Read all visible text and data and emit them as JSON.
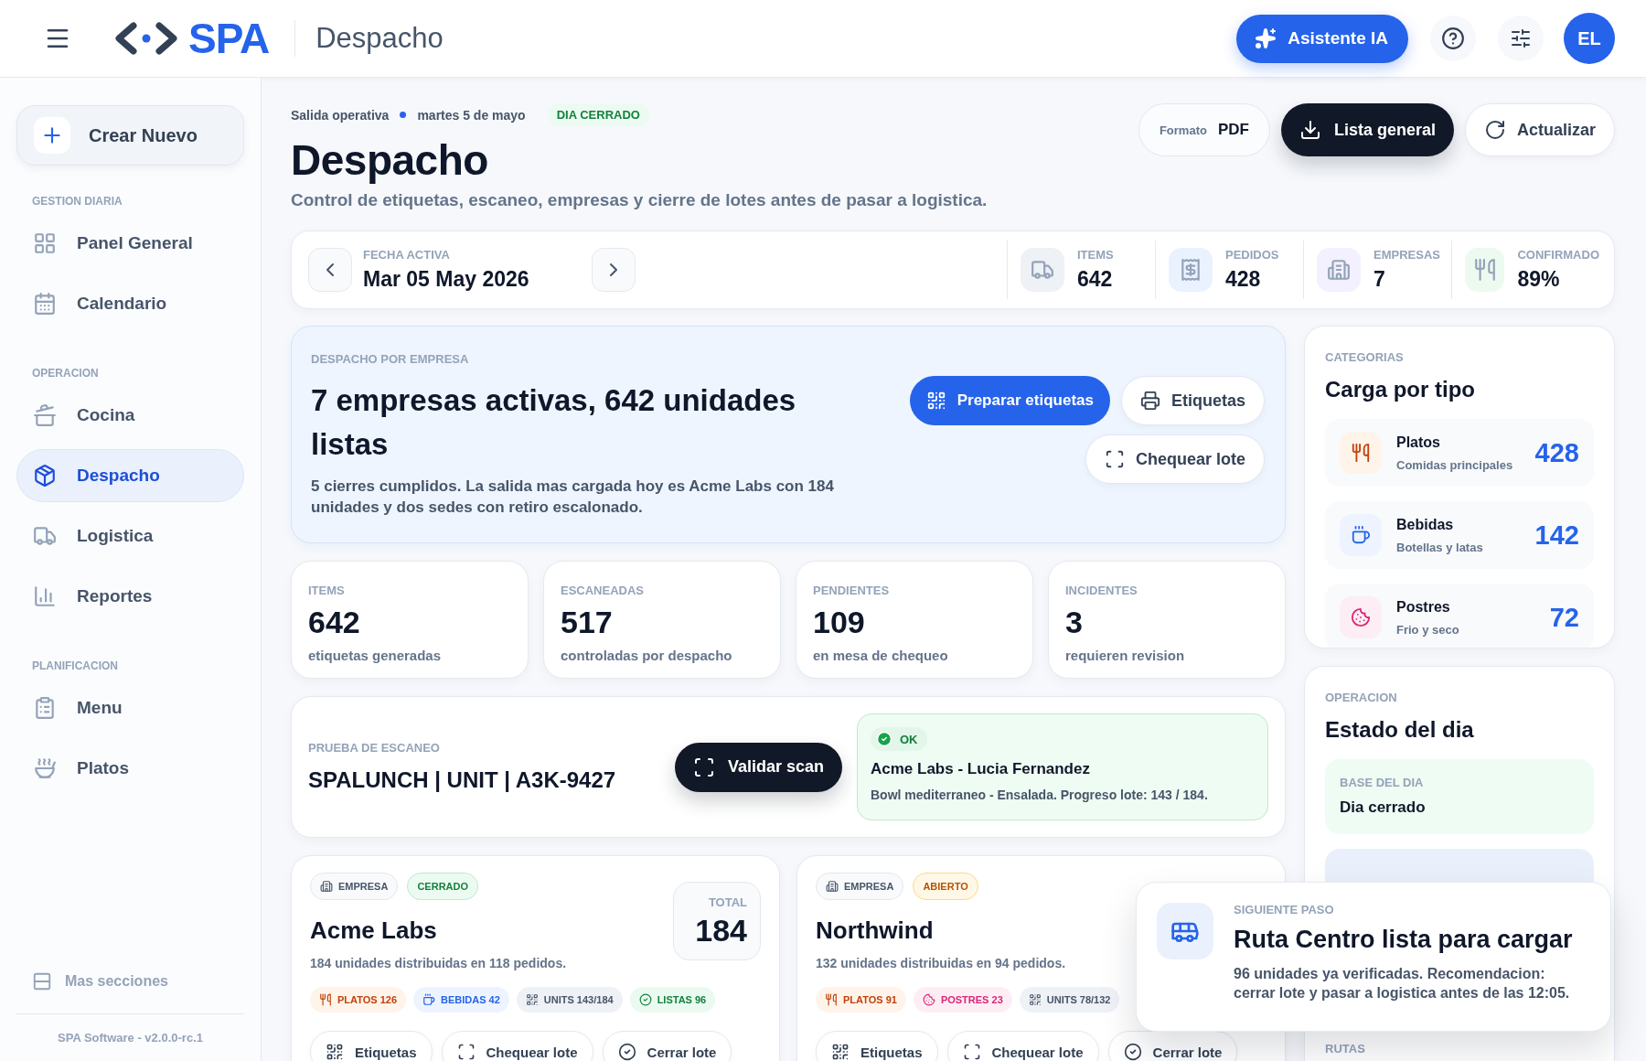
{
  "header": {
    "logo_text": "SPA",
    "page_title": "Despacho",
    "assistant_button": "Asistente IA",
    "avatar": "EL"
  },
  "sidebar": {
    "create_button": "Crear Nuevo",
    "sections": [
      {
        "title": "GESTION DIARIA",
        "items": [
          {
            "label": "Panel General",
            "selected": false
          },
          {
            "label": "Calendario",
            "selected": false
          }
        ]
      },
      {
        "title": "OPERACION",
        "items": [
          {
            "label": "Cocina",
            "selected": false
          },
          {
            "label": "Despacho",
            "selected": true
          },
          {
            "label": "Logistica",
            "selected": false
          },
          {
            "label": "Reportes",
            "selected": false
          }
        ]
      },
      {
        "title": "PLANIFICACION",
        "items": [
          {
            "label": "Menu",
            "selected": false
          },
          {
            "label": "Platos",
            "selected": false
          }
        ]
      }
    ],
    "more_link": "Mas secciones",
    "footer": "SPA Software - v2.0.0-rc.1"
  },
  "page": {
    "breadcrumb": [
      "Salida operativa",
      "martes 5 de mayo"
    ],
    "status_badge": "DIA CERRADO",
    "title": "Despacho",
    "subtitle": "Control de etiquetas, escaneo, empresas y cierre de lotes antes de pasar a logistica.",
    "format": {
      "label": "Formato",
      "value": "PDF"
    },
    "download_button": "Lista general",
    "refresh_button": "Actualizar"
  },
  "date_bar": {
    "label": "FECHA ACTIVA",
    "value": "Mar 05 May 2026",
    "metrics": [
      {
        "label": "ITEMS",
        "value": "642"
      },
      {
        "label": "PEDIDOS",
        "value": "428"
      },
      {
        "label": "EMPRESAS",
        "value": "7"
      },
      {
        "label": "CONFIRMADO",
        "value": "89%"
      }
    ]
  },
  "hero": {
    "eyebrow": "DESPACHO POR EMPRESA",
    "title": "7 empresas activas, 642 unidades listas",
    "text": "5 cierres cumplidos. La salida mas cargada hoy es Acme Labs con 184 unidades y dos sedes con retiro escalonado.",
    "buttons": [
      {
        "label": "Preparar etiquetas",
        "kind": "primary"
      },
      {
        "label": "Etiquetas",
        "kind": "print"
      },
      {
        "label": "Chequear lote",
        "kind": "scan"
      }
    ]
  },
  "stats": [
    {
      "label": "ITEMS",
      "value": "642",
      "caption": "etiquetas generadas"
    },
    {
      "label": "ESCANEADAS",
      "value": "517",
      "caption": "controladas por despacho"
    },
    {
      "label": "PENDIENTES",
      "value": "109",
      "caption": "en mesa de chequeo"
    },
    {
      "label": "INCIDENTES",
      "value": "3",
      "caption": "requieren revision"
    }
  ],
  "scan": {
    "eyebrow": "PRUEBA DE ESCANEO",
    "code": "SPALUNCH | UNIT | A3K-9427",
    "button": "Validar scan",
    "result": {
      "status": "OK",
      "title": "Acme Labs - Lucia Fernandez",
      "detail": "Bowl mediterraneo - Ensalada. Progreso lote: 143 / 184."
    }
  },
  "companies": [
    {
      "tag": "EMPRESA",
      "status": "CERRADO",
      "kind": "closed",
      "name": "Acme Labs",
      "summary": "184 unidades distribuidas en 118 pedidos.",
      "total_label": "TOTAL",
      "total": "184",
      "chips": [
        {
          "kind": "platos",
          "label": "PLATOS 126"
        },
        {
          "kind": "bebidas",
          "label": "BEBIDAS 42"
        },
        {
          "kind": "units",
          "label": "UNITS 143/184"
        },
        {
          "kind": "listas",
          "label": "LISTAS 96"
        }
      ],
      "actions": [
        "Etiquetas",
        "Chequear lote",
        "Cerrar lote"
      ]
    },
    {
      "tag": "EMPRESA",
      "status": "ABIERTO",
      "kind": "open",
      "name": "Northwind",
      "summary": "132 unidades distribuidas en 94 pedidos.",
      "chips": [
        {
          "kind": "platos",
          "label": "PLATOS 91"
        },
        {
          "kind": "postres",
          "label": "POSTRES 23"
        },
        {
          "kind": "units",
          "label": "UNITS 78/132"
        }
      ],
      "actions": [
        "Etiquetas",
        "Chequear lote",
        "Cerrar lote"
      ]
    }
  ],
  "categories": {
    "eyebrow": "CATEGORIAS",
    "title": "Carga por tipo",
    "items": [
      {
        "kind": "platos",
        "name": "Platos",
        "caption": "Comidas principales",
        "value": "428"
      },
      {
        "kind": "bebidas",
        "name": "Bebidas",
        "caption": "Botellas y latas",
        "value": "142"
      },
      {
        "kind": "postres",
        "name": "Postres",
        "caption": "Frio y seco",
        "value": "72"
      }
    ]
  },
  "day_status": {
    "eyebrow": "OPERACION",
    "title": "Estado del dia",
    "blocks": [
      {
        "kind": "base",
        "label": "BASE DEL DIA",
        "value": "Dia cerrado"
      },
      {
        "kind": "document"
      }
    ],
    "routes_label": "RUTAS"
  },
  "toast": {
    "eyebrow": "SIGUIENTE PASO",
    "title": "Ruta Centro lista para cargar",
    "text": "96 unidades ya verificadas. Recomendacion: cerrar lote y pasar a logistica antes de las 12:05."
  }
}
